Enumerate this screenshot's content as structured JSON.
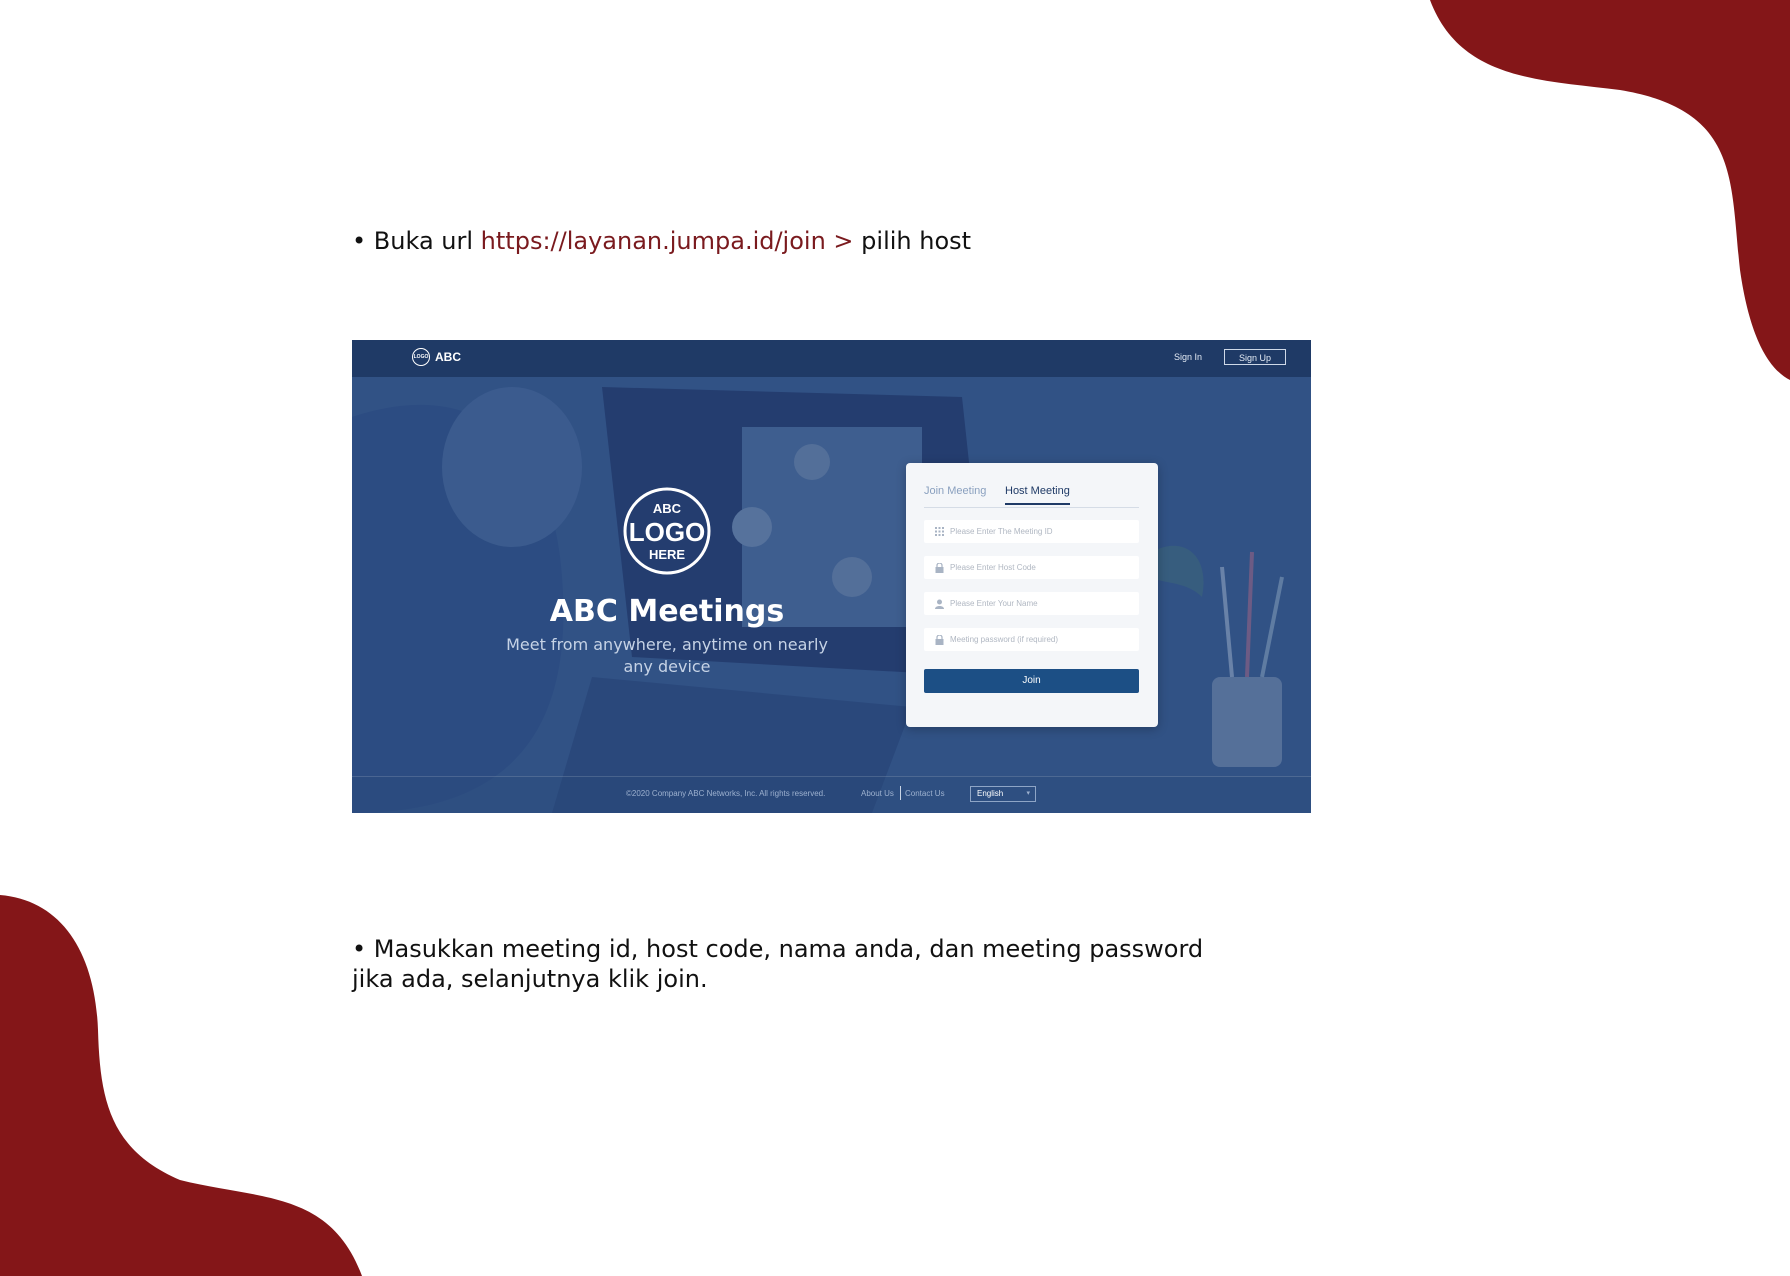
{
  "accent_color": "#7a1a1e",
  "instructions": {
    "step1": {
      "bullet": "•",
      "prefix": "Buka url",
      "link": "https://layanan.jumpa.id/join >",
      "suffix": "pilih host"
    },
    "step2": {
      "line1": "• Masukkan meeting id, host code, nama anda, dan meeting password",
      "line2": "jika ada, selanjutnya klik join."
    }
  },
  "screenshot": {
    "header": {
      "logo_text": "LOGO",
      "brand": "ABC",
      "sign_in": "Sign In",
      "sign_up": "Sign Up"
    },
    "hero": {
      "logo_top": "ABC",
      "logo_mid": "LOGO",
      "logo_bottom": "HERE",
      "title": "ABC Meetings",
      "subtitle_line1": "Meet from anywhere, anytime on nearly",
      "subtitle_line2": "any device"
    },
    "form": {
      "tab_join": "Join Meeting",
      "tab_host": "Host Meeting",
      "meeting_id_placeholder": "Please Enter The Meeting ID",
      "host_code_placeholder": "Please Enter Host Code",
      "name_placeholder": "Please Enter Your Name",
      "password_placeholder": "Meeting password (if required)",
      "join_label": "Join"
    },
    "footer": {
      "copyright": "©2020 Company ABC Networks, Inc. All rights reserved.",
      "about": "About Us",
      "contact": "Contact Us",
      "language": "English"
    }
  }
}
